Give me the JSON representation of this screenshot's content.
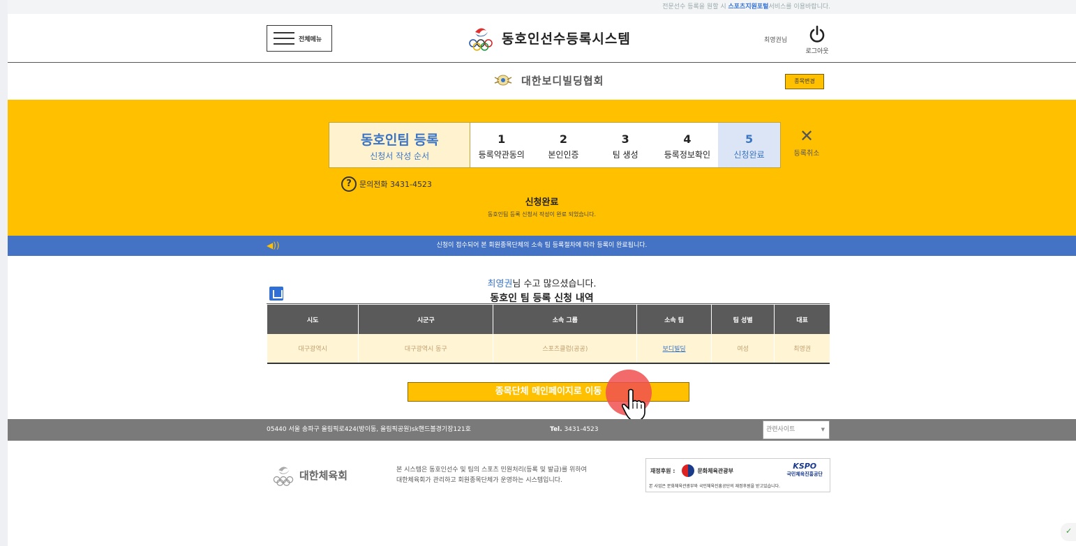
{
  "top_notice": {
    "prefix": "전문선수 등록을 원할 시 ",
    "link": "스포츠지원포털",
    "suffix": "서비스를 이용바랍니다."
  },
  "header": {
    "menu_label": "전체메뉴",
    "system_title": "동호인선수등록시스템",
    "user_name": "최영권님",
    "logout_label": "로그아웃"
  },
  "org": {
    "name": "대한보디빌딩협회",
    "change_button": "종목변경"
  },
  "steps": {
    "title": "동호인팀 등록",
    "subtitle": "신청서 작성 순서",
    "items": [
      {
        "num": "1",
        "label": "등록약관동의"
      },
      {
        "num": "2",
        "label": "본인인증"
      },
      {
        "num": "3",
        "label": "팀 생성"
      },
      {
        "num": "4",
        "label": "등록정보확인"
      },
      {
        "num": "5",
        "label": "신청완료"
      }
    ],
    "cancel_label": "등록취소",
    "phone": "문의전화 3431-4523",
    "done_title": "신청완료",
    "done_sub": "동호인팀 등록 신청서 작성이 완료 되었습니다."
  },
  "info_bar": "신청이 접수되어 본 회원종목단체의 소속 팀 등록절차에 따라 등록이 완료됩니다.",
  "thanks": {
    "name": "최영권",
    "line1_suffix": "님 수고 많으셨습니다.",
    "line2": "동호인 팀 등록 신청 내역"
  },
  "table": {
    "headers": [
      "시도",
      "시군구",
      "소속 그룹",
      "소속 팀",
      "팀 성별",
      "대표"
    ],
    "row": [
      "대구광역시",
      "대구광역시 동구",
      "스포츠클럽(공공)",
      "보디빌딩",
      "여성",
      "최영권"
    ]
  },
  "main_button": "종목단체 메인페이지로 이동",
  "footer": {
    "address": "05440 서울 송파구 올림픽로424(방이동, 올림픽공원)sk핸드볼경기장121호",
    "tel_label": "Tel.",
    "tel": "3431-4523",
    "site_select": "관련사이트",
    "org_name": "대한체육회",
    "desc1": "본 시스템은 동호인선수 및 팀의 스포츠 민원처리(등록 및 발급)를 위하여",
    "desc2": "대한체육회가 관리하고 회원종목단체가 운영하는 시스템입니다.",
    "sponsor_label": "재정후원 :",
    "sponsor_ministry": "문화체육관광부",
    "kspo": "KSPO",
    "kspo_name": "국민체육진흥공단",
    "sponsor_note": "본 사업은 문화체육관광부와 국민체육진흥공단의 재정후원을 받고있습니다."
  },
  "colors": {
    "accent": "#ffc000",
    "blue": "#4472c4",
    "link": "#3a74c4",
    "footer": "#7a7a7a"
  }
}
